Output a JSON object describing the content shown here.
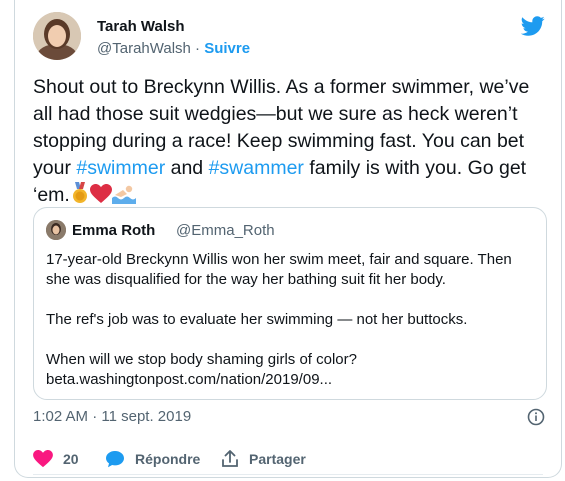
{
  "author": {
    "name": "Tarah Walsh",
    "handle": "@TarahWalsh",
    "separator": " · ",
    "follow_label": "Suivre"
  },
  "tweet": {
    "text_1": "Shout out to Breckynn Willis. As a former swimmer, we’ve all had those suit wedgies—but we sure as heck weren’t stopping during a race! Keep swimming fast. You can bet your ",
    "hashtag_1": "#swimmer",
    "text_2": " and ",
    "hashtag_2": "#swammer",
    "text_3": " family is with you. Go get ‘em."
  },
  "quote": {
    "name": "Emma Roth",
    "handle": "@Emma_Roth",
    "para1": "17-year-old Breckynn Willis won her swim meet, fair and square. Then she was disqualified for the way her bathing suit fit her body.",
    "para2": "The ref's job was to evaluate her swimming — not her buttocks.",
    "para3": "When will we stop body shaming girls of color?",
    "link": "beta.washingtonpost.com/nation/2019/09..."
  },
  "timestamp": "1:02 AM · 11 sept. 2019",
  "actions": {
    "like_count": "20",
    "reply_label": "Répondre",
    "share_label": "Partager"
  },
  "colors": {
    "link": "#1d9bf0",
    "like": "#f91880",
    "muted": "#536471"
  }
}
